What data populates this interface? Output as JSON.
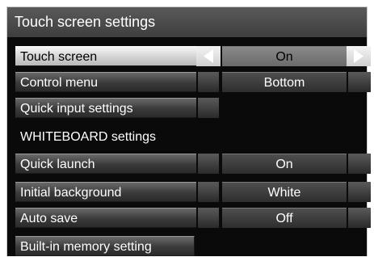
{
  "title": "Touch screen settings",
  "rows": [
    {
      "label": "Touch screen",
      "value": "On"
    },
    {
      "label": "Control menu",
      "value": "Bottom"
    },
    {
      "label": "Quick input settings"
    }
  ],
  "section": {
    "label": "WHITEBOARD settings"
  },
  "whiteboard_rows": [
    {
      "label": "Quick launch",
      "value": "On"
    },
    {
      "label": "Initial background",
      "value": "White"
    },
    {
      "label": "Auto save",
      "value": "Off"
    },
    {
      "label": "Built-in memory setting"
    }
  ]
}
